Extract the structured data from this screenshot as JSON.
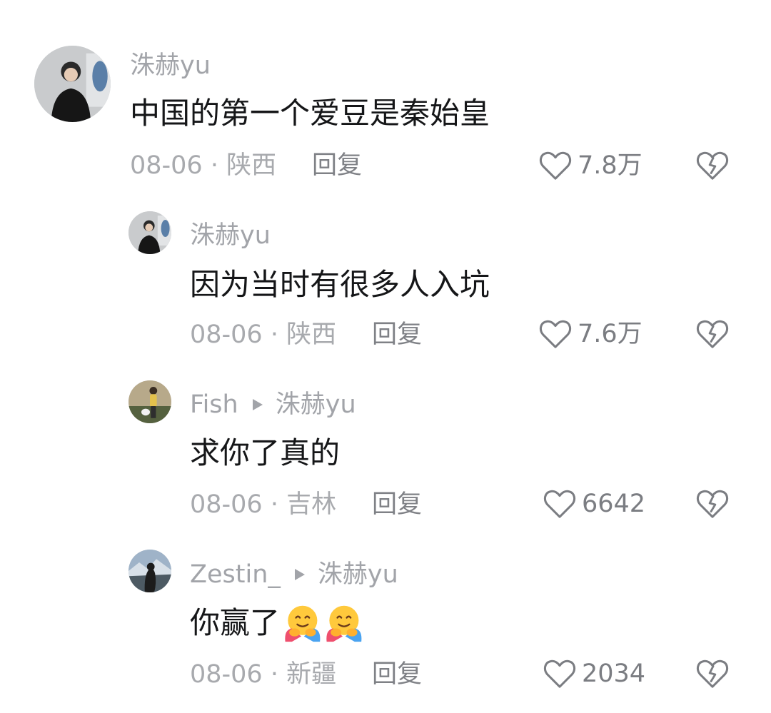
{
  "comments": [
    {
      "author": "洙赫yu",
      "reply_to": "",
      "text": "中国的第一个爱豆是秦始皇",
      "date": "08-06",
      "separator": "·",
      "location": "陕西",
      "reply_label": "回复",
      "likes": "7.8万",
      "emoji_count": 0,
      "avatar": "avatar-man-black-shirt"
    },
    {
      "author": "洙赫yu",
      "reply_to": "",
      "text": "因为当时有很多人入坑",
      "date": "08-06",
      "separator": "·",
      "location": "陕西",
      "reply_label": "回复",
      "likes": "7.6万",
      "emoji_count": 0,
      "avatar": "avatar-man-black-shirt"
    },
    {
      "author": "Fish",
      "reply_to": "洙赫yu",
      "text": "求你了真的",
      "date": "08-06",
      "separator": "·",
      "location": "吉林",
      "reply_label": "回复",
      "likes": "6642",
      "emoji_count": 0,
      "avatar": "avatar-person-with-dog"
    },
    {
      "author": "Zestin_",
      "reply_to": "洙赫yu",
      "text": "你赢了",
      "date": "08-06",
      "separator": "·",
      "location": "新疆",
      "reply_label": "回复",
      "likes": "2034",
      "emoji_count": 2,
      "avatar": "avatar-silhouette-mountains"
    }
  ],
  "icons": {
    "like": "heart-outline-icon",
    "dislike": "broken-heart-icon",
    "reply_arrow": "play-triangle-icon",
    "emoji": "hugging-face-emoji"
  },
  "colors": {
    "name": "#a2a4a9",
    "text": "#151618",
    "meta": "#a8aaae",
    "action": "#7b7d82"
  }
}
